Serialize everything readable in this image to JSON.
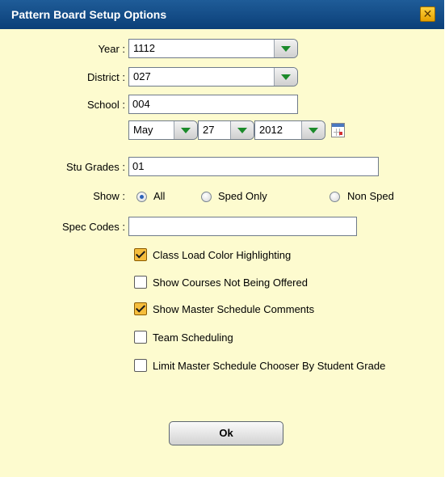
{
  "dialog": {
    "title": "Pattern Board Setup Options",
    "close_glyph": "✕"
  },
  "form": {
    "year": {
      "label": "Year :",
      "value": "1112"
    },
    "district": {
      "label": "District :",
      "value": "027"
    },
    "school": {
      "label": "School :",
      "value": "004"
    },
    "date": {
      "month": "May",
      "day": "27",
      "year": "2012",
      "icon": "calendar-icon"
    },
    "stu_grades": {
      "label": "Stu Grades :",
      "value": "01"
    },
    "show": {
      "label": "Show :",
      "options": [
        "All",
        "Sped Only",
        "Non Sped"
      ],
      "selected": "All"
    },
    "spec_codes": {
      "label": "Spec Codes :",
      "value": ""
    },
    "checkboxes": [
      {
        "label": "Class Load Color Highlighting",
        "checked": true
      },
      {
        "label": "Show Courses Not Being Offered",
        "checked": false
      },
      {
        "label": "Show Master Schedule Comments",
        "checked": true
      },
      {
        "label": "Team Scheduling",
        "checked": false
      },
      {
        "label": "Limit Master Schedule Chooser By Student Grade",
        "checked": false
      }
    ]
  },
  "footer": {
    "ok_label": "Ok"
  },
  "colors": {
    "title_bar": "#0b3f78",
    "dialog_bg": "#fdfbcf",
    "checkbox_checked": "#f5bd3c",
    "dropdown_arrow": "#1b8a2a"
  }
}
